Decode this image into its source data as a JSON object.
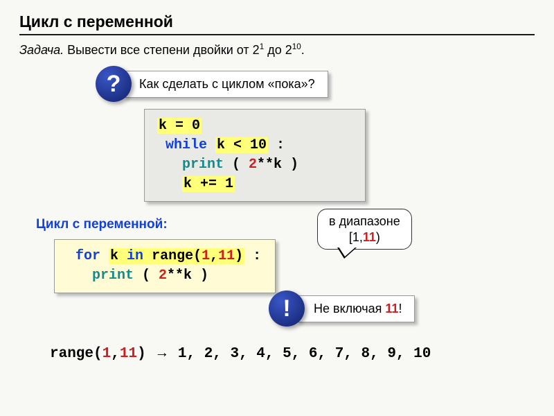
{
  "heading": "Цикл с переменной",
  "task_label": "Задача.",
  "task_body_pre": " Вывести все степени двойки от 2",
  "task_exp1": "1",
  "task_mid": " до 2",
  "task_exp2": "10",
  "task_end": ".",
  "q_mark": "?",
  "q_text": "Как сделать с циклом «пока»?",
  "code_while": {
    "l1a": "k = 0",
    "l2a": " while ",
    "l2b": "k < 10",
    "l2c": " :",
    "l3a": "   print",
    "l3b": " ( ",
    "l3c": "2",
    "l3d": "**k )",
    "l4a": "   ",
    "l4b": "k += 1"
  },
  "section_label": "Цикл с переменной:",
  "range_callout_l1": "в диапазоне",
  "range_callout_l2a": "[1,",
  "range_callout_l2b": "11",
  "range_callout_l2c": ")",
  "code_for": {
    "l1a": " for",
    "l1b": " ",
    "l1c": "k ",
    "l1d": "in",
    "l1e": " range(",
    "l1f": "1",
    "l1g": ",",
    "l1h": "11",
    "l1i": ")",
    "l1j": " :",
    "l2a": "   print",
    "l2b": " ( ",
    "l2c": "2",
    "l2d": "**k )"
  },
  "excl_mark": "!",
  "excl_text_a": "Не включая ",
  "excl_text_b": "11",
  "excl_text_c": "!",
  "range_line": {
    "a": "range(",
    "b": "1",
    "c": ",",
    "d": "11",
    "e": ") ",
    "arrow": "→",
    "f": " 1, 2, 3, 4, 5, 6, 7, 8, 9, 10"
  }
}
